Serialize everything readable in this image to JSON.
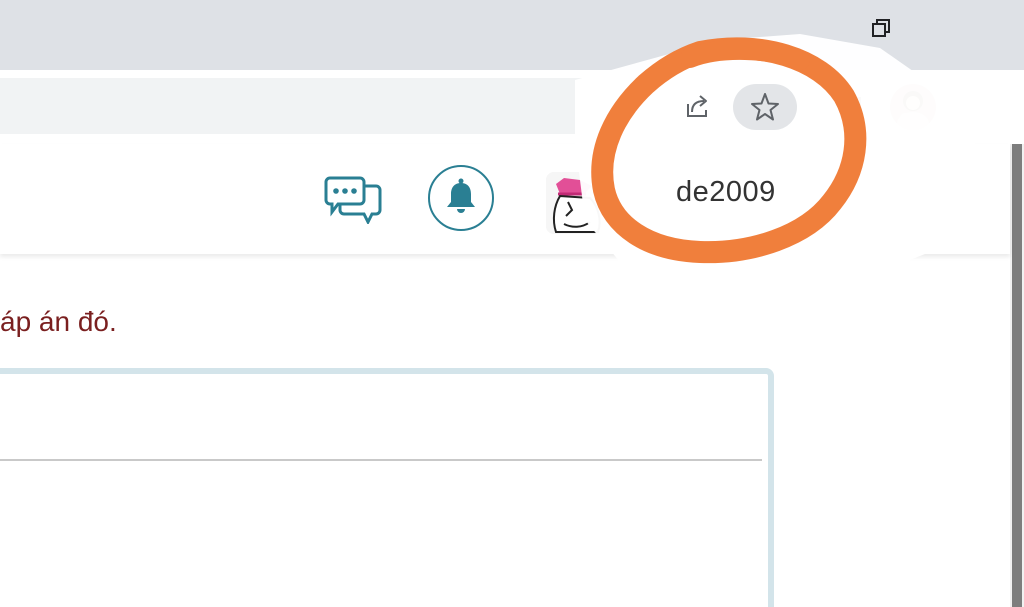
{
  "browser": {
    "restore_icon": "window-restore-icon",
    "share_icon": "share-icon",
    "bookmark_icon": "star-icon",
    "extensions_icon": "puzzle-icon",
    "profile_icon": "profile-avatar"
  },
  "site_header": {
    "chat_icon": "chat-bubbles-icon",
    "notification_icon": "bell-icon",
    "username": "de2009"
  },
  "content": {
    "text": "áp án đó."
  },
  "annotation": {
    "shape": "hand-drawn circle",
    "color": "#f07f3c"
  },
  "colors": {
    "accent": "#2a7f93",
    "content_text": "#7a1f1f",
    "editor_border": "#d3e4ea",
    "chrome_bg": "#dee1e6"
  }
}
